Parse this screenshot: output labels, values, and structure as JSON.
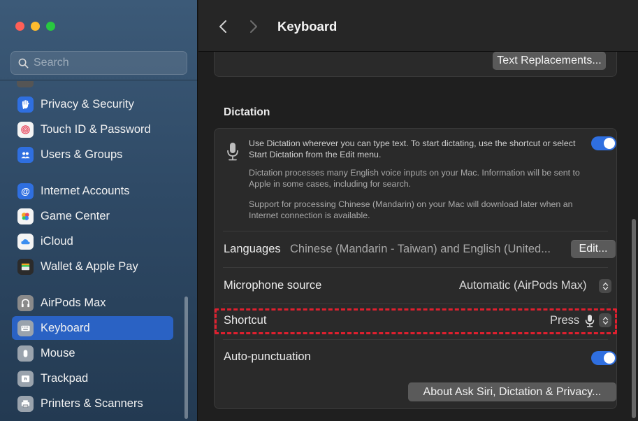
{
  "window": {
    "title": "Keyboard"
  },
  "colors": {
    "accent": "#2a62c4",
    "toggle_on": "#2f6fe0",
    "highlight": "#e01f2e"
  },
  "search": {
    "placeholder": "Search",
    "value": ""
  },
  "sidebar": {
    "items": [
      {
        "label": "Privacy & Security",
        "icon": "hand-icon"
      },
      {
        "label": "Touch ID & Password",
        "icon": "fingerprint-icon"
      },
      {
        "label": "Users & Groups",
        "icon": "users-icon"
      },
      {
        "label": "Internet Accounts",
        "icon": "at-icon"
      },
      {
        "label": "Game Center",
        "icon": "game-center-icon"
      },
      {
        "label": "iCloud",
        "icon": "cloud-icon"
      },
      {
        "label": "Wallet & Apple Pay",
        "icon": "wallet-icon"
      },
      {
        "label": "AirPods Max",
        "icon": "headphones-icon"
      },
      {
        "label": "Keyboard",
        "icon": "keyboard-icon",
        "selected": true
      },
      {
        "label": "Mouse",
        "icon": "mouse-icon"
      },
      {
        "label": "Trackpad",
        "icon": "trackpad-icon"
      },
      {
        "label": "Printers & Scanners",
        "icon": "printer-icon"
      }
    ]
  },
  "main": {
    "text_replacements_button": "Text Replacements...",
    "dictation": {
      "section_title": "Dictation",
      "description_1": "Use Dictation wherever you can type text. To start dictating, use the shortcut or select Start Dictation from the Edit menu.",
      "description_2": "Dictation processes many English voice inputs on your Mac. Information will be sent to Apple in some cases, including for search.",
      "description_3": "Support for processing Chinese (Mandarin) on your Mac will download later when an Internet connection is available.",
      "enabled": true,
      "languages_label": "Languages",
      "languages_value": "Chinese (Mandarin - Taiwan) and English (United...",
      "edit_button": "Edit...",
      "microphone_label": "Microphone source",
      "microphone_value": "Automatic (AirPods Max)",
      "shortcut_label": "Shortcut",
      "shortcut_value": "Press",
      "autopunct_label": "Auto-punctuation",
      "autopunct_enabled": true,
      "about_button": "About Ask Siri, Dictation & Privacy..."
    }
  }
}
